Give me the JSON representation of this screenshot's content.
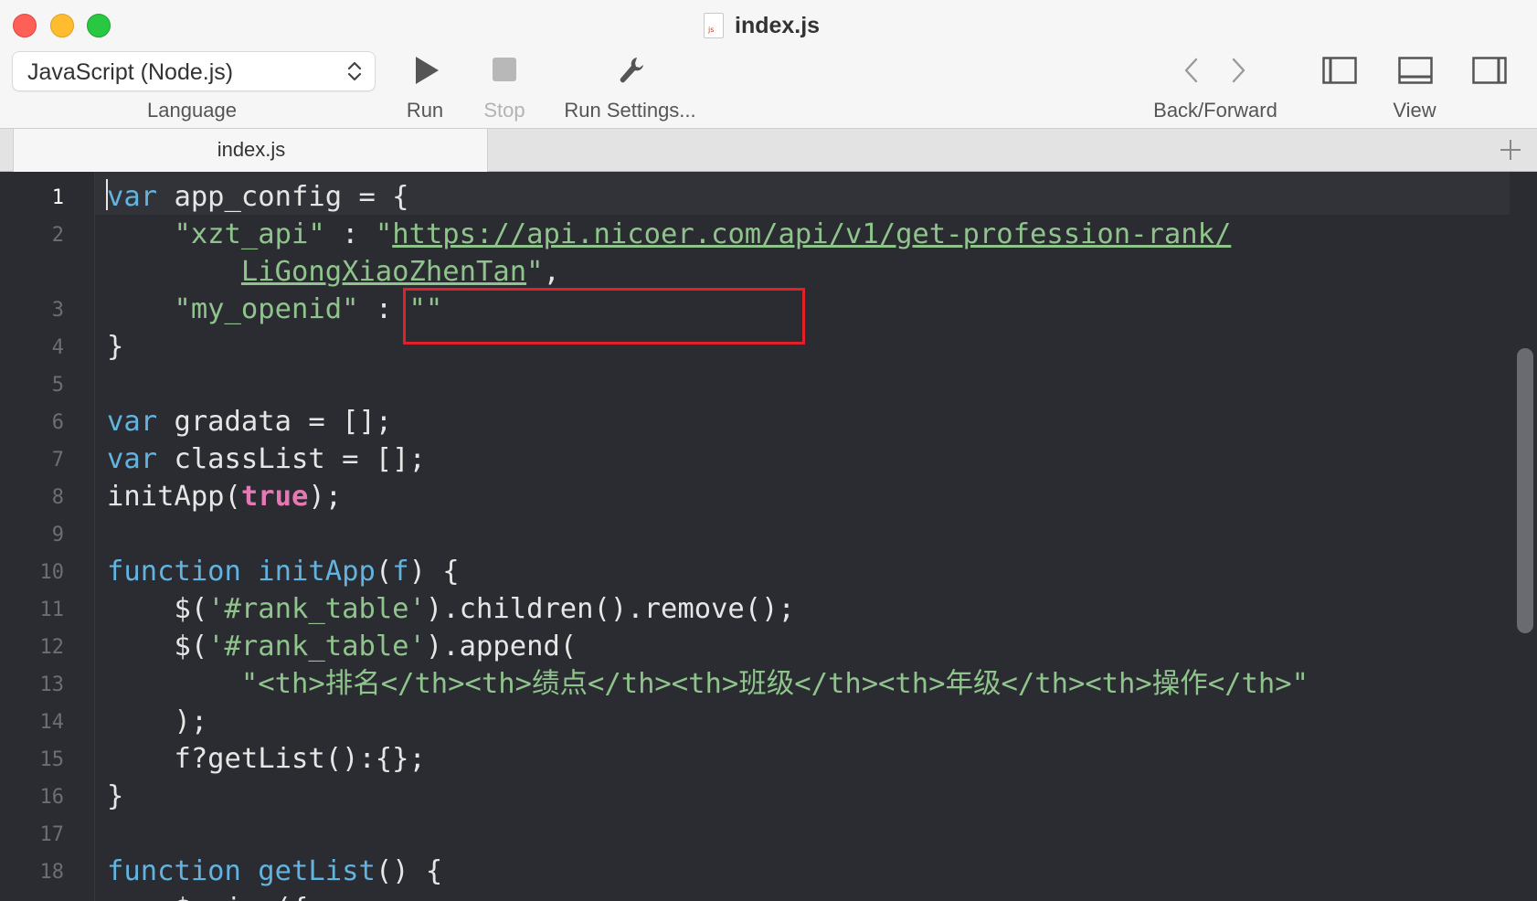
{
  "window": {
    "title": "index.js",
    "doc_icon_text": "js"
  },
  "toolbar": {
    "language": {
      "value": "JavaScript (Node.js)",
      "label": "Language"
    },
    "run_label": "Run",
    "stop_label": "Stop",
    "run_settings_label": "Run Settings...",
    "back_forward_label": "Back/Forward",
    "view_label": "View"
  },
  "tabs": [
    {
      "label": "index.js",
      "active": true
    }
  ],
  "editor": {
    "current_line": 1,
    "line_numbers": [
      "1",
      "2",
      "",
      "3",
      "4",
      "5",
      "6",
      "7",
      "8",
      "9",
      "10",
      "11",
      "12",
      "13",
      "14",
      "15",
      "16",
      "17",
      "18"
    ],
    "lines": [
      [
        {
          "t": "kw",
          "v": "var"
        },
        {
          "t": "plain",
          "v": " app_config = {"
        }
      ],
      [
        {
          "t": "plain",
          "v": "    "
        },
        {
          "t": "str",
          "v": "\"xzt_api\""
        },
        {
          "t": "plain",
          "v": " : "
        },
        {
          "t": "str",
          "v": "\""
        },
        {
          "t": "url",
          "v": "https://api.nicoer.com/api/v1/get-profession-rank/"
        }
      ],
      [
        {
          "t": "plain",
          "v": "        "
        },
        {
          "t": "url",
          "v": "LiGongXiaoZhenTan"
        },
        {
          "t": "str",
          "v": "\""
        },
        {
          "t": "plain",
          "v": ","
        }
      ],
      [
        {
          "t": "plain",
          "v": "    "
        },
        {
          "t": "str",
          "v": "\"my_openid\""
        },
        {
          "t": "plain",
          "v": " : "
        },
        {
          "t": "str",
          "v": "\"\""
        }
      ],
      [
        {
          "t": "plain",
          "v": "}"
        }
      ],
      [],
      [
        {
          "t": "kw",
          "v": "var"
        },
        {
          "t": "plain",
          "v": " gradata = [];"
        }
      ],
      [
        {
          "t": "kw",
          "v": "var"
        },
        {
          "t": "plain",
          "v": " classList = [];"
        }
      ],
      [
        {
          "t": "plain",
          "v": "initApp("
        },
        {
          "t": "bool",
          "v": "true"
        },
        {
          "t": "plain",
          "v": ");"
        }
      ],
      [],
      [
        {
          "t": "kw",
          "v": "function"
        },
        {
          "t": "plain",
          "v": " "
        },
        {
          "t": "fn",
          "v": "initApp"
        },
        {
          "t": "plain",
          "v": "("
        },
        {
          "t": "fn",
          "v": "f"
        },
        {
          "t": "plain",
          "v": ") {"
        }
      ],
      [
        {
          "t": "plain",
          "v": "    $("
        },
        {
          "t": "str",
          "v": "'#rank_table'"
        },
        {
          "t": "plain",
          "v": ").children().remove();"
        }
      ],
      [
        {
          "t": "plain",
          "v": "    $("
        },
        {
          "t": "str",
          "v": "'#rank_table'"
        },
        {
          "t": "plain",
          "v": ").append("
        }
      ],
      [
        {
          "t": "plain",
          "v": "        "
        },
        {
          "t": "str",
          "v": "\"<th>排名</th><th>绩点</th><th>班级</th><th>年级</th><th>操作</th>\""
        }
      ],
      [
        {
          "t": "plain",
          "v": "    );"
        }
      ],
      [
        {
          "t": "plain",
          "v": "    f?getList():{};"
        }
      ],
      [
        {
          "t": "plain",
          "v": "}"
        }
      ],
      [],
      [
        {
          "t": "kw",
          "v": "function"
        },
        {
          "t": "plain",
          "v": " "
        },
        {
          "t": "fn",
          "v": "getList"
        },
        {
          "t": "plain",
          "v": "() {"
        }
      ],
      [
        {
          "t": "plain",
          "v": "    $.ajax({"
        }
      ]
    ]
  }
}
